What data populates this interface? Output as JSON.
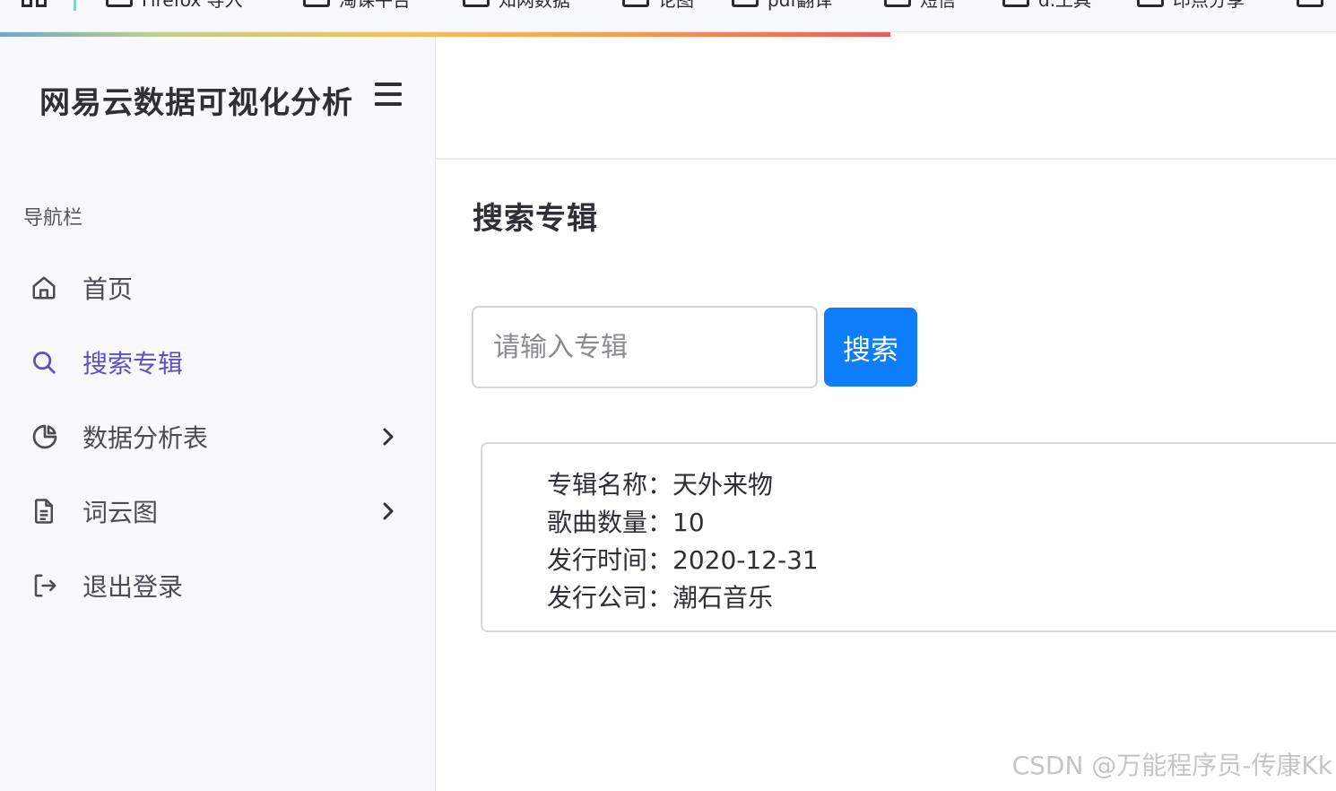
{
  "browser": {
    "bookmarks": [
      "Firefox 导入",
      "淘课平台",
      "知网数据",
      "论图",
      "pdf翻译",
      "短信",
      "d.工具",
      "印点分享",
      ""
    ]
  },
  "sidebar": {
    "brand": "网易云数据可视化分析",
    "nav_heading": "导航栏",
    "items": [
      {
        "label": "首页",
        "icon": "home-icon",
        "active": false
      },
      {
        "label": "搜索专辑",
        "icon": "search-icon",
        "active": true
      },
      {
        "label": "数据分析表",
        "icon": "pie-chart-icon",
        "active": false,
        "expandable": true
      },
      {
        "label": "词云图",
        "icon": "document-icon",
        "active": false,
        "expandable": true
      },
      {
        "label": "退出登录",
        "icon": "logout-icon",
        "active": false
      }
    ]
  },
  "main": {
    "title": "搜索专辑",
    "search": {
      "placeholder": "请输入专辑",
      "value": "",
      "button_label": "搜索"
    },
    "result": {
      "rows": [
        {
          "label": "专辑名称：",
          "value": "天外来物"
        },
        {
          "label": "歌曲数量：",
          "value": "10"
        },
        {
          "label": "发行时间：",
          "value": "2020-12-31"
        },
        {
          "label": "发行公司：",
          "value": "潮石音乐"
        }
      ]
    }
  },
  "watermark": "CSDN @万能程序员-传康Kk",
  "colors": {
    "accent": "#5b4fc4",
    "button": "#0d7dfa",
    "sidebar_bg": "#f9f9fd"
  }
}
